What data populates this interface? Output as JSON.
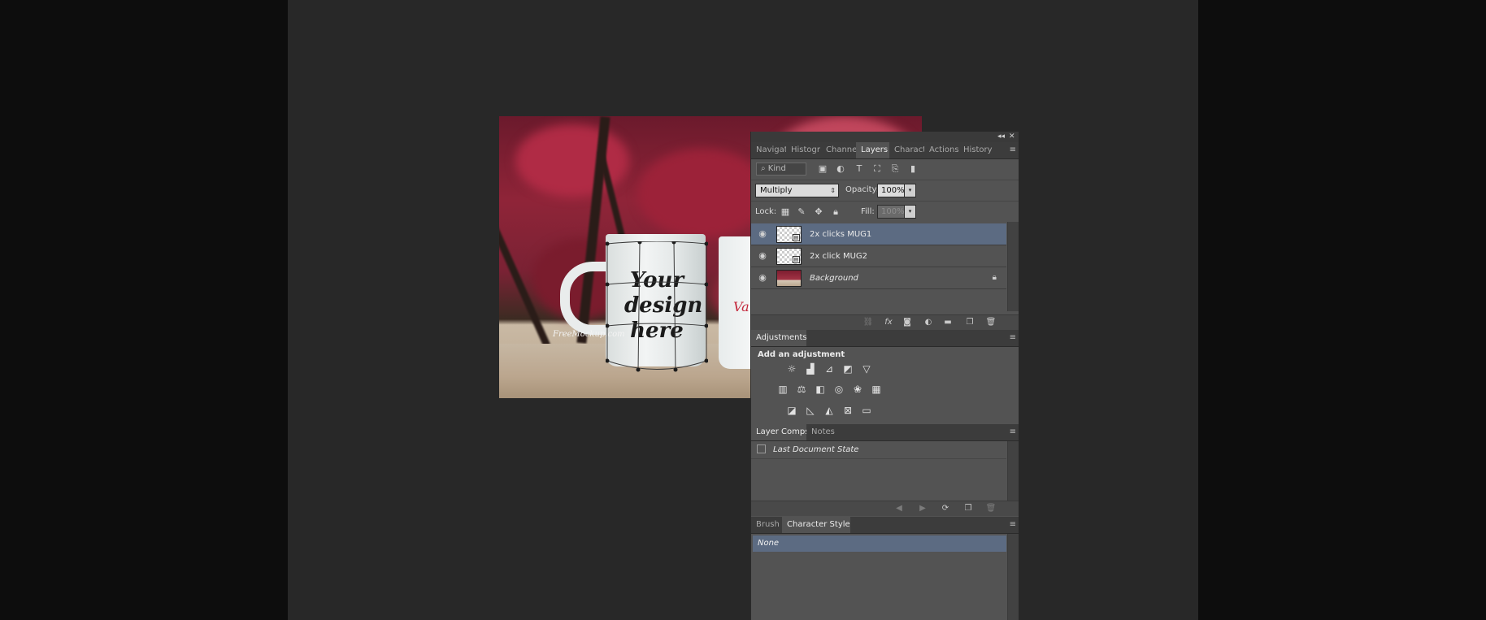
{
  "app": "Adobe Photoshop",
  "canvas": {
    "mug_design_text": [
      "Your",
      "design",
      "here"
    ],
    "watermark": "FreeMockup.com",
    "mug2_text": "Va"
  },
  "panel_controls": {
    "collapse": "◂◂",
    "close": "✕"
  },
  "top_tabs": [
    "Navigat",
    "Histogr",
    "Channel",
    "Layers",
    "Charact",
    "Actions",
    "History"
  ],
  "top_tabs_active": "Layers",
  "menu_icon": "≡",
  "layers": {
    "kind_filter": "Kind",
    "filter_icons": [
      "image-filter-icon",
      "adjustment-filter-icon",
      "type-filter-icon",
      "shape-filter-icon",
      "smart-object-filter-icon",
      "filter-toggle-icon"
    ],
    "blend_mode": "Multiply",
    "opacity_label": "Opacity:",
    "opacity_value": "100%",
    "lock_label": "Lock:",
    "fill_label": "Fill:",
    "fill_value": "100%",
    "items": [
      {
        "name": "2x clicks MUG1",
        "selected": true,
        "smart_object": true
      },
      {
        "name": "2x click MUG2",
        "selected": false,
        "smart_object": true
      },
      {
        "name": "Background",
        "selected": false,
        "locked": true
      }
    ],
    "bottom_icons": [
      "link-layers-icon",
      "fx-icon",
      "add-mask-icon",
      "new-adjustment-icon",
      "new-group-icon",
      "new-layer-icon",
      "delete-layer-icon"
    ]
  },
  "adjustments": {
    "tab": "Adjustments",
    "title": "Add an adjustment",
    "rows": [
      [
        "brightness-contrast-icon",
        "levels-icon",
        "curves-icon",
        "exposure-icon",
        "vibrance-icon"
      ],
      [
        "hue-saturation-icon",
        "color-balance-icon",
        "black-white-icon",
        "photo-filter-icon",
        "channel-mixer-icon",
        "color-lookup-icon"
      ],
      [
        "invert-icon",
        "posterize-icon",
        "threshold-icon",
        "selective-color-icon",
        "gradient-map-icon"
      ]
    ]
  },
  "layer_comps": {
    "tabs": [
      "Layer Comps",
      "Notes"
    ],
    "active": "Layer Comps",
    "items": [
      "Last Document State"
    ]
  },
  "character_styles": {
    "tabs": [
      "Brush",
      "Character Styles"
    ],
    "active": "Character Styles",
    "items": [
      "None"
    ]
  }
}
